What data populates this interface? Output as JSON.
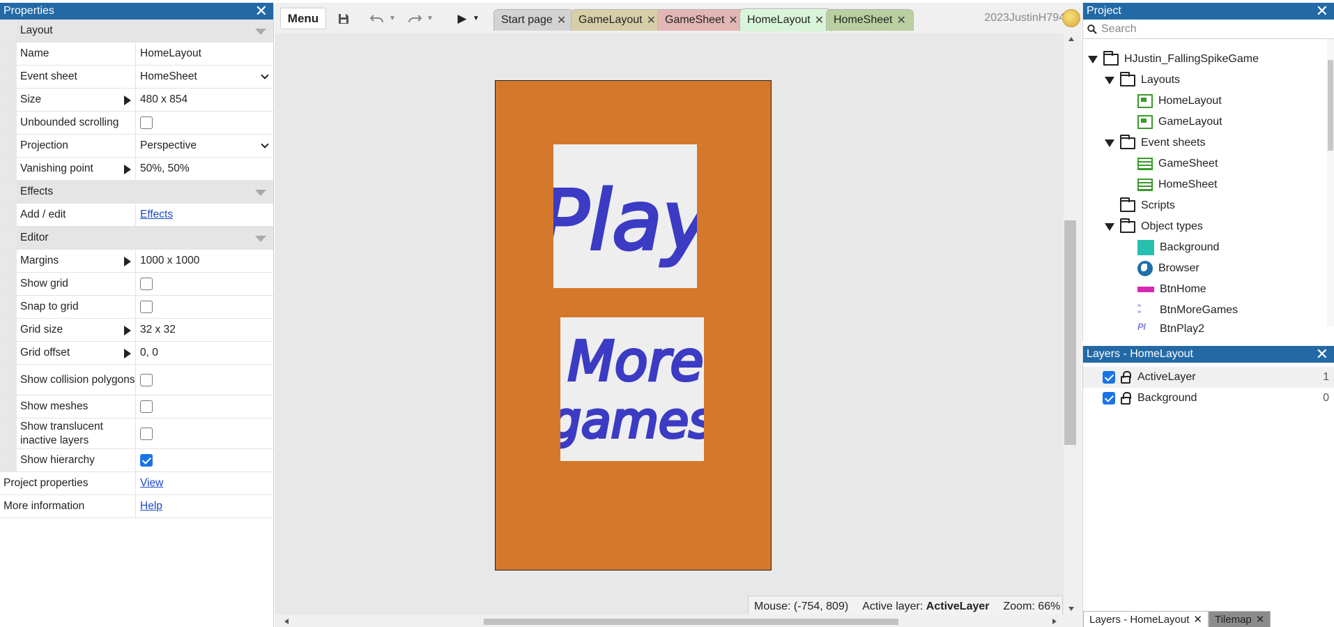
{
  "properties": {
    "title": "Properties",
    "sections": {
      "layout": "Layout",
      "effects": "Effects",
      "editor": "Editor"
    },
    "rows": {
      "name": {
        "label": "Name",
        "value": "HomeLayout"
      },
      "event_sheet": {
        "label": "Event sheet",
        "value": "HomeSheet"
      },
      "size": {
        "label": "Size",
        "value": "480 x 854"
      },
      "unbounded": {
        "label": "Unbounded scrolling",
        "checked": false
      },
      "projection": {
        "label": "Projection",
        "value": "Perspective"
      },
      "vanishing": {
        "label": "Vanishing point",
        "value": "50%, 50%"
      },
      "add_edit": {
        "label": "Add / edit",
        "link": "Effects"
      },
      "margins": {
        "label": "Margins",
        "value": "1000 x 1000"
      },
      "show_grid": {
        "label": "Show grid",
        "checked": false
      },
      "snap": {
        "label": "Snap to grid",
        "checked": false
      },
      "grid_size": {
        "label": "Grid size",
        "value": "32 x 32"
      },
      "grid_offset": {
        "label": "Grid offset",
        "value": "0, 0"
      },
      "collision": {
        "label": "Show collision polygons",
        "checked": false
      },
      "meshes": {
        "label": "Show meshes",
        "checked": false
      },
      "translucent": {
        "label": "Show translucent inactive layers",
        "checked": false
      },
      "hierarchy": {
        "label": "Show hierarchy",
        "checked": true
      },
      "project_props": {
        "label": "Project properties",
        "link": "View"
      },
      "more_info": {
        "label": "More information",
        "link": "Help"
      }
    }
  },
  "toolbar": {
    "menu_label": "Menu",
    "user": "2023JustinH794",
    "tabs": [
      {
        "label": "Start page",
        "color": "#d3d3d3"
      },
      {
        "label": "GameLayout",
        "color": "#d8cfa8"
      },
      {
        "label": "GameSheet",
        "color": "#e3b6b6"
      },
      {
        "label": "HomeLayout",
        "color": "#d9f5d9"
      },
      {
        "label": "HomeSheet",
        "color": "#b9cfa0"
      }
    ]
  },
  "canvas": {
    "layout_bg": "#d4782c",
    "play_text": "Play",
    "more_text_1": "More",
    "more_text_2": "games"
  },
  "status": {
    "mouse": "Mouse: (-754, 809)",
    "active_layer_label": "Active layer:",
    "active_layer": "ActiveLayer",
    "zoom": "Zoom: 66%"
  },
  "project": {
    "title": "Project",
    "search_placeholder": "Search",
    "root": "HJustin_FallingSpikeGame",
    "layouts_folder": "Layouts",
    "layouts": [
      "HomeLayout",
      "GameLayout"
    ],
    "sheets_folder": "Event sheets",
    "sheets": [
      "GameSheet",
      "HomeSheet"
    ],
    "scripts_folder": "Scripts",
    "objects_folder": "Object types",
    "objects": [
      "Background",
      "Browser",
      "BtnHome",
      "BtnMoreGames",
      "BtnPlay2"
    ]
  },
  "layers": {
    "title": "Layers - HomeLayout",
    "items": [
      {
        "name": "ActiveLayer",
        "index": "1"
      },
      {
        "name": "Background",
        "index": "0"
      }
    ],
    "bottom_tabs": [
      "Layers - HomeLayout",
      "Tilemap"
    ]
  }
}
